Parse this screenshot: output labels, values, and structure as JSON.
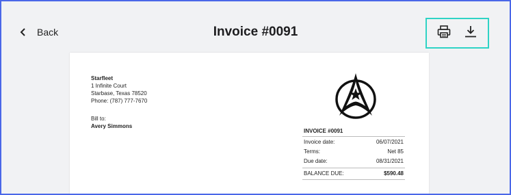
{
  "header": {
    "back_label": "Back",
    "title": "Invoice #0091"
  },
  "toolbar": {
    "print_icon": "printer-icon",
    "download_icon": "download-icon"
  },
  "colors": {
    "frame_border": "#4a67e8",
    "toolbar_highlight": "#2ed3c5"
  },
  "invoice": {
    "sender": {
      "name": "Starfleet",
      "address1": "1 Infinite Court",
      "address2": "Starbase, Texas 78520",
      "phone": "Phone: (787) 777-7670"
    },
    "bill_to_label": "Bill to:",
    "client": "Avery Simmons",
    "logo": "starfleet-delta-logo",
    "number": "INVOICE #0091",
    "rows": [
      {
        "label": "Invoice date:",
        "value": "06/07/2021"
      },
      {
        "label": "Terms:",
        "value": "Net 85"
      },
      {
        "label": "Due date:",
        "value": "08/31/2021"
      }
    ],
    "balance_label": "BALANCE DUE:",
    "balance_value": "$590.48"
  }
}
